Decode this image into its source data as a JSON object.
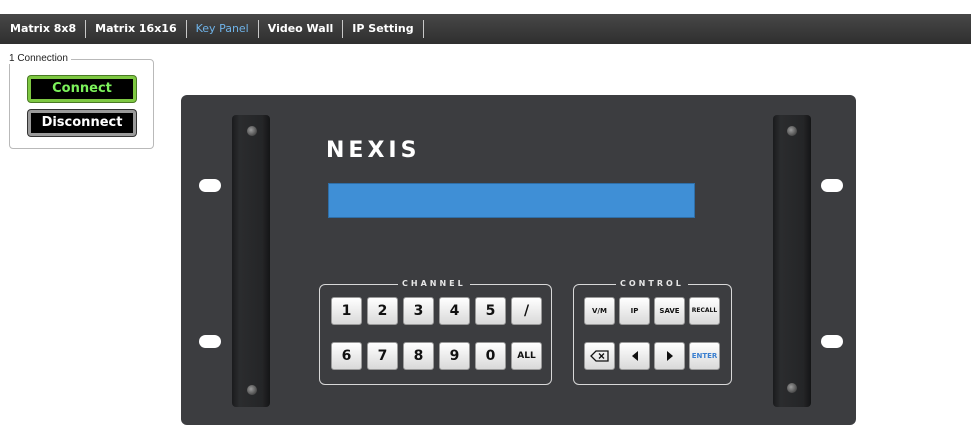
{
  "nav": {
    "tabs": [
      {
        "label": "Matrix 8x8"
      },
      {
        "label": "Matrix 16x16"
      },
      {
        "label": "Key Panel",
        "active": true
      },
      {
        "label": "Video Wall"
      },
      {
        "label": "IP Setting"
      }
    ]
  },
  "connection": {
    "legend": "1 Connection",
    "connect_label": "Connect",
    "disconnect_label": "Disconnect"
  },
  "panel": {
    "logo": "NEXIS",
    "channel": {
      "title": "CHANNEL",
      "row1": [
        "1",
        "2",
        "3",
        "4",
        "5",
        "/"
      ],
      "row2": [
        "6",
        "7",
        "8",
        "9",
        "0",
        "ALL"
      ]
    },
    "control": {
      "title": "CONTROL",
      "row1": [
        "V/M",
        "IP",
        "SAVE",
        "RECALL"
      ],
      "row2_icons": [
        "backspace-icon",
        "left-arrow-icon",
        "right-arrow-icon"
      ],
      "enter_label": "ENTER"
    }
  },
  "colors": {
    "nav_bg": "#3a3a3a",
    "active_tab": "#6fb3e8",
    "connect_text": "#7cf25b",
    "lcd": "#3f8fd6",
    "panel_bg": "#3c3d40"
  }
}
